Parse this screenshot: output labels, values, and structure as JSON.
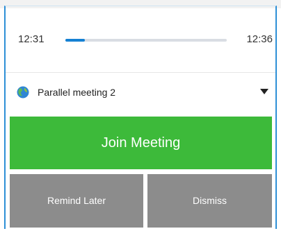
{
  "timeline": {
    "start_time": "12:31",
    "end_time": "12:36",
    "progress_fraction": 0.12,
    "progress_color": "#1581d3"
  },
  "meeting": {
    "name": "Parallel meeting 2",
    "icon": "globe-icon",
    "dropdown_icon": "triangle-down-icon"
  },
  "actions": {
    "join_label": "Join Meeting",
    "remind_label": "Remind Later",
    "dismiss_label": "Dismiss"
  },
  "colors": {
    "join": "#3dba3a",
    "secondary": "#8c8c8c",
    "accent_border": "#2d8fd6"
  }
}
